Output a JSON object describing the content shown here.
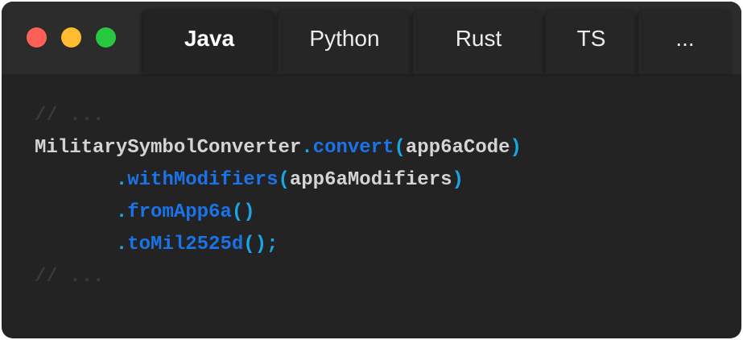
{
  "window": {
    "traffic_lights": [
      {
        "name": "close",
        "color": "#fe5f57"
      },
      {
        "name": "minimize",
        "color": "#febc2e"
      },
      {
        "name": "maximize",
        "color": "#28c840"
      }
    ]
  },
  "tabs": [
    {
      "label": "Java",
      "active": true
    },
    {
      "label": "Python",
      "active": false
    },
    {
      "label": "Rust",
      "active": false
    },
    {
      "label": "TS",
      "active": false
    },
    {
      "label": "...",
      "active": false
    }
  ],
  "code": {
    "comment_top": "// ...",
    "comment_bottom": "// ...",
    "class_name": "MilitarySymbolConverter",
    "method_convert": "convert",
    "arg_code": "app6aCode",
    "method_modifiers": "withModifiers",
    "arg_modifiers": "app6aModifiers",
    "method_from": "fromApp6a",
    "method_to": "toMil2525d",
    "terminator": ";",
    "indent": "       "
  },
  "colors": {
    "background": "#232323",
    "titlebar": "#2c2c2c",
    "comment": "#3a3a3a",
    "identifier": "#d4d4d4",
    "method": "#1a73e8",
    "punctuation": "#1aa7e6"
  }
}
